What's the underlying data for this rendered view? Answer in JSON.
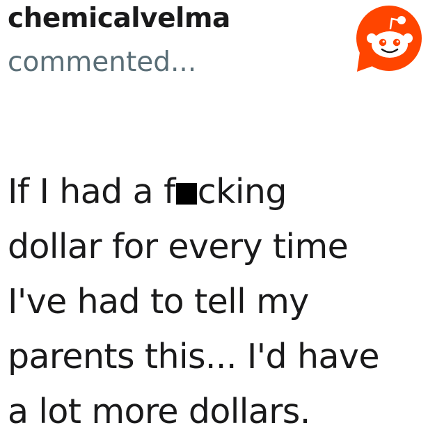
{
  "post": {
    "username": "chemicalvelma",
    "action": "commented...",
    "logo_icon": "reddit-snoo-icon",
    "colors": {
      "brand": "#ff4500",
      "username": "#1a1a1b",
      "action": "#5a6e77",
      "censor": "#000000"
    },
    "comment": {
      "line1_before_censor": "If I had a f",
      "line1_after_censor": "cking",
      "line2": "dollar for every time",
      "line3": "I've had to tell my",
      "line4": "parents this... I'd have",
      "line5": "a lot more dollars."
    }
  }
}
